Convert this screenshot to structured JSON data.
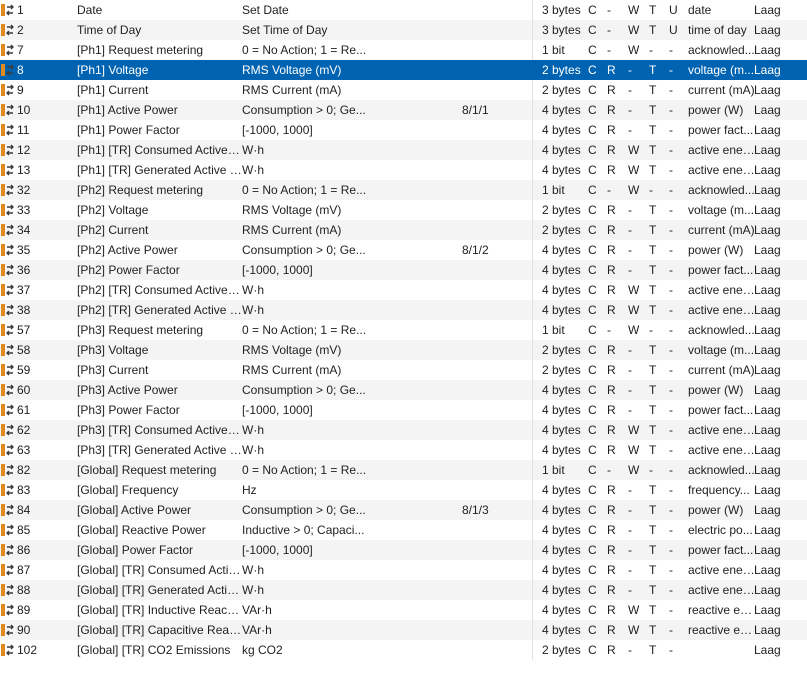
{
  "colors": {
    "selected_bg": "#0063b1",
    "alt_row_bg": "#f4f4f4",
    "icon_orange": "#e08a1e",
    "icon_arrow": "#3a3a3a"
  },
  "row_icon": "group-object-icon",
  "rows": [
    {
      "num": "1",
      "name": "Date",
      "desc": "Set Date",
      "ga": "",
      "len": "3 bytes",
      "c": "C",
      "r": "-",
      "w": "W",
      "t": "T",
      "u": "U",
      "dpt": "date",
      "prio": "Laag"
    },
    {
      "num": "2",
      "name": "Time of Day",
      "desc": "Set Time of Day",
      "ga": "",
      "len": "3 bytes",
      "c": "C",
      "r": "-",
      "w": "W",
      "t": "T",
      "u": "U",
      "dpt": "time of day",
      "prio": "Laag"
    },
    {
      "num": "7",
      "name": "[Ph1] Request metering",
      "desc": "0 = No Action; 1 = Re...",
      "ga": "",
      "len": "1 bit",
      "c": "C",
      "r": "-",
      "w": "W",
      "t": "-",
      "u": "-",
      "dpt": "acknowled...",
      "prio": "Laag"
    },
    {
      "num": "8",
      "name": "[Ph1] Voltage",
      "desc": "RMS Voltage (mV)",
      "ga": "",
      "len": "2 bytes",
      "c": "C",
      "r": "R",
      "w": "-",
      "t": "T",
      "u": "-",
      "dpt": "voltage (m...",
      "prio": "Laag",
      "selected": true
    },
    {
      "num": "9",
      "name": "[Ph1] Current",
      "desc": "RMS Current (mA)",
      "ga": "",
      "len": "2 bytes",
      "c": "C",
      "r": "R",
      "w": "-",
      "t": "T",
      "u": "-",
      "dpt": "current (mA)",
      "prio": "Laag"
    },
    {
      "num": "10",
      "name": "[Ph1] Active Power",
      "desc": "Consumption > 0; Ge...",
      "ga": "8/1/1",
      "len": "4 bytes",
      "c": "C",
      "r": "R",
      "w": "-",
      "t": "T",
      "u": "-",
      "dpt": "power (W)",
      "prio": "Laag"
    },
    {
      "num": "11",
      "name": "[Ph1] Power Factor",
      "desc": "[-1000, 1000]",
      "ga": "",
      "len": "4 bytes",
      "c": "C",
      "r": "R",
      "w": "-",
      "t": "T",
      "u": "-",
      "dpt": "power fact...",
      "prio": "Laag"
    },
    {
      "num": "12",
      "name": "[Ph1] [TR] Consumed Active E...",
      "desc": "W·h",
      "ga": "",
      "len": "4 bytes",
      "c": "C",
      "r": "R",
      "w": "W",
      "t": "T",
      "u": "-",
      "dpt": "active ener...",
      "prio": "Laag"
    },
    {
      "num": "13",
      "name": "[Ph1] [TR] Generated Active En...",
      "desc": "W·h",
      "ga": "",
      "len": "4 bytes",
      "c": "C",
      "r": "R",
      "w": "W",
      "t": "T",
      "u": "-",
      "dpt": "active ener...",
      "prio": "Laag"
    },
    {
      "num": "32",
      "name": "[Ph2] Request metering",
      "desc": "0 = No Action; 1 = Re...",
      "ga": "",
      "len": "1 bit",
      "c": "C",
      "r": "-",
      "w": "W",
      "t": "-",
      "u": "-",
      "dpt": "acknowled...",
      "prio": "Laag"
    },
    {
      "num": "33",
      "name": "[Ph2] Voltage",
      "desc": "RMS Voltage (mV)",
      "ga": "",
      "len": "2 bytes",
      "c": "C",
      "r": "R",
      "w": "-",
      "t": "T",
      "u": "-",
      "dpt": "voltage (m...",
      "prio": "Laag"
    },
    {
      "num": "34",
      "name": "[Ph2] Current",
      "desc": "RMS Current (mA)",
      "ga": "",
      "len": "2 bytes",
      "c": "C",
      "r": "R",
      "w": "-",
      "t": "T",
      "u": "-",
      "dpt": "current (mA)",
      "prio": "Laag"
    },
    {
      "num": "35",
      "name": "[Ph2] Active Power",
      "desc": "Consumption > 0; Ge...",
      "ga": "8/1/2",
      "len": "4 bytes",
      "c": "C",
      "r": "R",
      "w": "-",
      "t": "T",
      "u": "-",
      "dpt": "power (W)",
      "prio": "Laag"
    },
    {
      "num": "36",
      "name": "[Ph2] Power Factor",
      "desc": "[-1000, 1000]",
      "ga": "",
      "len": "4 bytes",
      "c": "C",
      "r": "R",
      "w": "-",
      "t": "T",
      "u": "-",
      "dpt": "power fact...",
      "prio": "Laag"
    },
    {
      "num": "37",
      "name": "[Ph2] [TR] Consumed Active E...",
      "desc": "W·h",
      "ga": "",
      "len": "4 bytes",
      "c": "C",
      "r": "R",
      "w": "W",
      "t": "T",
      "u": "-",
      "dpt": "active ener...",
      "prio": "Laag"
    },
    {
      "num": "38",
      "name": "[Ph2] [TR] Generated Active E...",
      "desc": "W·h",
      "ga": "",
      "len": "4 bytes",
      "c": "C",
      "r": "R",
      "w": "W",
      "t": "T",
      "u": "-",
      "dpt": "active ener...",
      "prio": "Laag"
    },
    {
      "num": "57",
      "name": "[Ph3] Request metering",
      "desc": "0 = No Action; 1 = Re...",
      "ga": "",
      "len": "1 bit",
      "c": "C",
      "r": "-",
      "w": "W",
      "t": "-",
      "u": "-",
      "dpt": "acknowled...",
      "prio": "Laag"
    },
    {
      "num": "58",
      "name": "[Ph3] Voltage",
      "desc": "RMS Voltage (mV)",
      "ga": "",
      "len": "2 bytes",
      "c": "C",
      "r": "R",
      "w": "-",
      "t": "T",
      "u": "-",
      "dpt": "voltage (m...",
      "prio": "Laag"
    },
    {
      "num": "59",
      "name": "[Ph3] Current",
      "desc": "RMS Current (mA)",
      "ga": "",
      "len": "2 bytes",
      "c": "C",
      "r": "R",
      "w": "-",
      "t": "T",
      "u": "-",
      "dpt": "current (mA)",
      "prio": "Laag"
    },
    {
      "num": "60",
      "name": "[Ph3] Active Power",
      "desc": "Consumption > 0; Ge...",
      "ga": "",
      "len": "4 bytes",
      "c": "C",
      "r": "R",
      "w": "-",
      "t": "T",
      "u": "-",
      "dpt": "power (W)",
      "prio": "Laag"
    },
    {
      "num": "61",
      "name": "[Ph3] Power Factor",
      "desc": "[-1000, 1000]",
      "ga": "",
      "len": "4 bytes",
      "c": "C",
      "r": "R",
      "w": "-",
      "t": "T",
      "u": "-",
      "dpt": "power fact...",
      "prio": "Laag"
    },
    {
      "num": "62",
      "name": "[Ph3] [TR] Consumed Active E...",
      "desc": "W·h",
      "ga": "",
      "len": "4 bytes",
      "c": "C",
      "r": "R",
      "w": "W",
      "t": "T",
      "u": "-",
      "dpt": "active ener...",
      "prio": "Laag"
    },
    {
      "num": "63",
      "name": "[Ph3] [TR] Generated Active E...",
      "desc": "W·h",
      "ga": "",
      "len": "4 bytes",
      "c": "C",
      "r": "R",
      "w": "W",
      "t": "T",
      "u": "-",
      "dpt": "active ener...",
      "prio": "Laag"
    },
    {
      "num": "82",
      "name": "[Global] Request metering",
      "desc": "0 = No Action; 1 = Re...",
      "ga": "",
      "len": "1 bit",
      "c": "C",
      "r": "-",
      "w": "W",
      "t": "-",
      "u": "-",
      "dpt": "acknowled...",
      "prio": "Laag"
    },
    {
      "num": "83",
      "name": "[Global] Frequency",
      "desc": "Hz",
      "ga": "",
      "len": "4 bytes",
      "c": "C",
      "r": "R",
      "w": "-",
      "t": "T",
      "u": "-",
      "dpt": "frequency...",
      "prio": "Laag"
    },
    {
      "num": "84",
      "name": "[Global] Active Power",
      "desc": "Consumption > 0; Ge...",
      "ga": "8/1/3",
      "len": "4 bytes",
      "c": "C",
      "r": "R",
      "w": "-",
      "t": "T",
      "u": "-",
      "dpt": "power (W)",
      "prio": "Laag"
    },
    {
      "num": "85",
      "name": "[Global] Reactive Power",
      "desc": "Inductive > 0; Capaci...",
      "ga": "",
      "len": "4 bytes",
      "c": "C",
      "r": "R",
      "w": "-",
      "t": "T",
      "u": "-",
      "dpt": "electric po...",
      "prio": "Laag"
    },
    {
      "num": "86",
      "name": "[Global] Power Factor",
      "desc": "[-1000, 1000]",
      "ga": "",
      "len": "4 bytes",
      "c": "C",
      "r": "R",
      "w": "-",
      "t": "T",
      "u": "-",
      "dpt": "power fact...",
      "prio": "Laag"
    },
    {
      "num": "87",
      "name": "[Global] [TR] Consumed Activ...",
      "desc": "W·h",
      "ga": "",
      "len": "4 bytes",
      "c": "C",
      "r": "R",
      "w": "-",
      "t": "T",
      "u": "-",
      "dpt": "active ener...",
      "prio": "Laag"
    },
    {
      "num": "88",
      "name": "[Global] [TR] Generated Active...",
      "desc": "W·h",
      "ga": "",
      "len": "4 bytes",
      "c": "C",
      "r": "R",
      "w": "-",
      "t": "T",
      "u": "-",
      "dpt": "active ener...",
      "prio": "Laag"
    },
    {
      "num": "89",
      "name": "[Global] [TR] Inductive Reactiv...",
      "desc": "VAr·h",
      "ga": "",
      "len": "4 bytes",
      "c": "C",
      "r": "R",
      "w": "W",
      "t": "T",
      "u": "-",
      "dpt": "reactive en...",
      "prio": "Laag"
    },
    {
      "num": "90",
      "name": "[Global] [TR] Capacitive Reacti...",
      "desc": "VAr·h",
      "ga": "",
      "len": "4 bytes",
      "c": "C",
      "r": "R",
      "w": "W",
      "t": "T",
      "u": "-",
      "dpt": "reactive en...",
      "prio": "Laag"
    },
    {
      "num": "102",
      "name": "[Global] [TR] CO2 Emissions",
      "desc": "kg CO2",
      "ga": "",
      "len": "2 bytes",
      "c": "C",
      "r": "R",
      "w": "-",
      "t": "T",
      "u": "-",
      "dpt": "",
      "prio": "Laag"
    }
  ]
}
